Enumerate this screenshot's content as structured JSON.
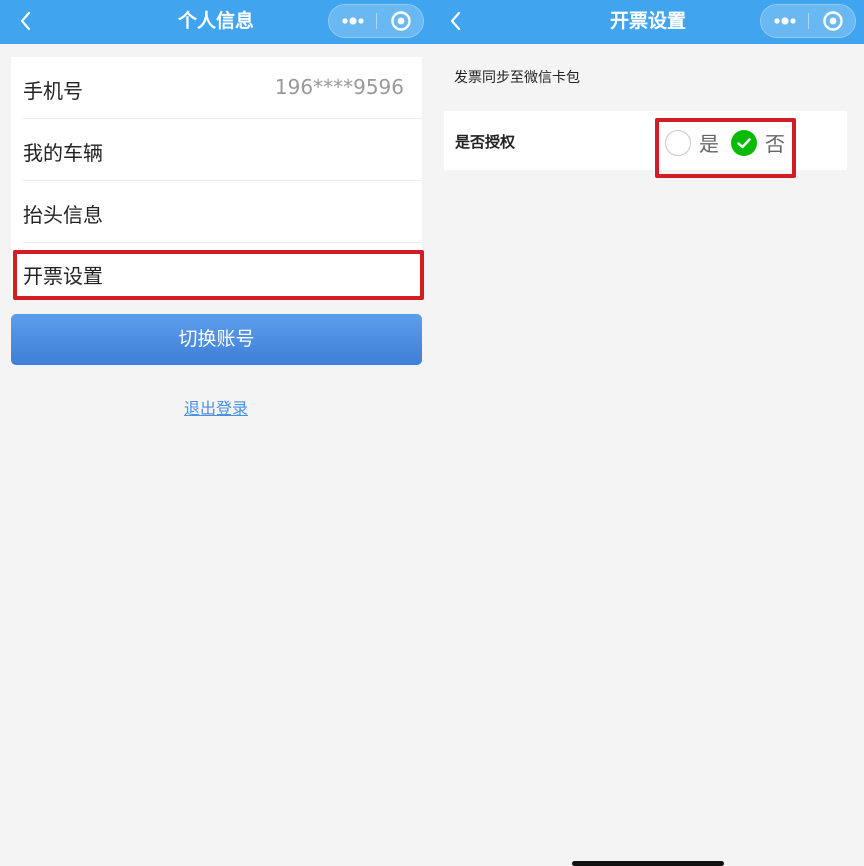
{
  "left": {
    "nav_title": "个人信息",
    "rows": [
      {
        "label": "手机号",
        "value": "196****9596"
      },
      {
        "label": "我的车辆"
      },
      {
        "label": "抬头信息"
      },
      {
        "label": "开票设置"
      }
    ],
    "switch_account": "切换账号",
    "logout": "退出登录"
  },
  "right": {
    "nav_title": "开票设置",
    "sync_text": "发票同步至微信卡包",
    "authorize_label": "是否授权",
    "option_yes": "是",
    "option_no": "否",
    "selected": "否"
  },
  "colors": {
    "navbar": "#41a4ef",
    "highlight": "#d41c24",
    "button": "#4a8ce3",
    "link": "#4a90e2",
    "radio_selected": "#09bb07"
  }
}
